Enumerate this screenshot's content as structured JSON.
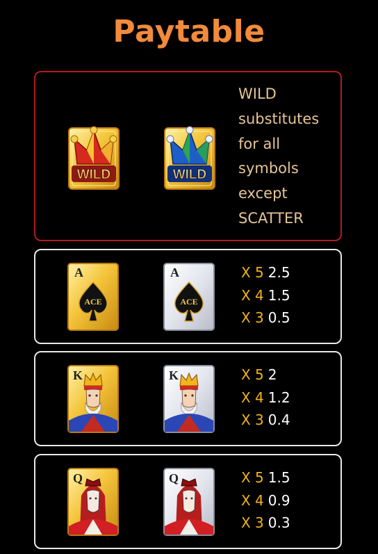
{
  "title": "Paytable",
  "wild": {
    "symbols": [
      {
        "icon": "jester-wild-red-icon",
        "label": "WILD"
      },
      {
        "icon": "jester-wild-blue-icon",
        "label": "WILD"
      }
    ],
    "description_lines": [
      "WILD",
      "substitutes",
      "for all",
      "symbols",
      "except",
      "SCATTER"
    ]
  },
  "rows": [
    {
      "symbols": [
        {
          "icon": "ace-card-gold-icon",
          "rank": "A",
          "badge": "ACE"
        },
        {
          "icon": "ace-card-silver-icon",
          "rank": "A",
          "badge": "ACE"
        }
      ],
      "pays": [
        {
          "mult": "X 5",
          "value": "2.5"
        },
        {
          "mult": "X 4",
          "value": "1.5"
        },
        {
          "mult": "X 3",
          "value": "0.5"
        }
      ]
    },
    {
      "symbols": [
        {
          "icon": "king-card-gold-icon",
          "rank": "K"
        },
        {
          "icon": "king-card-silver-icon",
          "rank": "K"
        }
      ],
      "pays": [
        {
          "mult": "X 5",
          "value": "2"
        },
        {
          "mult": "X 4",
          "value": "1.2"
        },
        {
          "mult": "X 3",
          "value": "0.4"
        }
      ]
    },
    {
      "symbols": [
        {
          "icon": "queen-card-gold-icon",
          "rank": "Q"
        },
        {
          "icon": "queen-card-silver-icon",
          "rank": "Q"
        }
      ],
      "pays": [
        {
          "mult": "X 5",
          "value": "1.5"
        },
        {
          "mult": "X 4",
          "value": "0.9"
        },
        {
          "mult": "X 3",
          "value": "0.3"
        }
      ]
    }
  ],
  "colors": {
    "title": "#f28a3c",
    "wild_border": "#b31b1e",
    "panel_border": "#e9e9e9",
    "wild_text": "#e6c596",
    "multiplier": "#f2b31a",
    "value": "#ffffff"
  }
}
